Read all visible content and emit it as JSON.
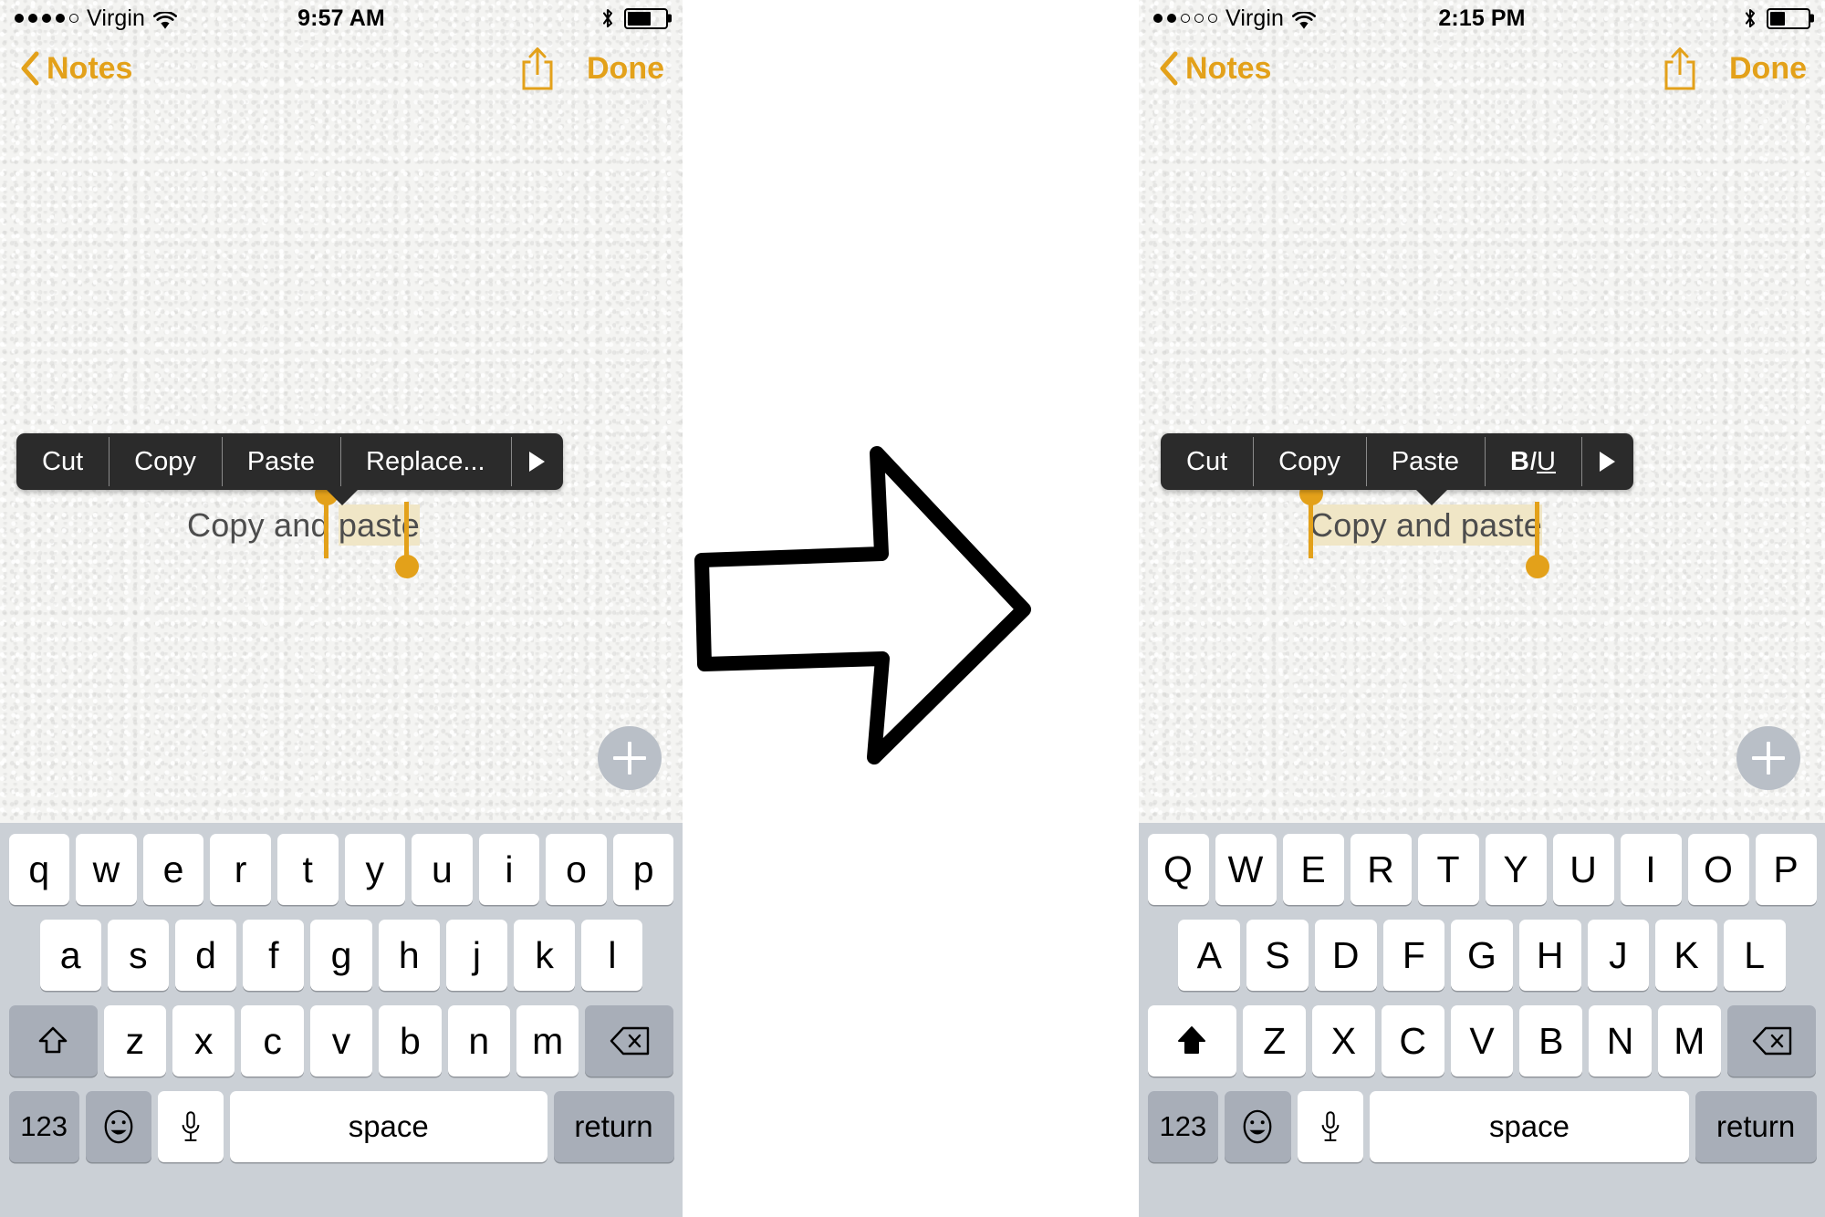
{
  "colors": {
    "accent_gold": "#e3a11a",
    "selection_highlight": "#f0e6c6",
    "callout_bg": "#2b2b2b",
    "keyboard_bg": "#cbd0d6",
    "key_bg": "#ffffff",
    "modifier_key_bg": "#a8aeb8",
    "note_paper": "#f4f4f2",
    "note_text": "#4d4d4d",
    "plus_button_bg": "#b9bfc7"
  },
  "panels": [
    {
      "id": "before",
      "status_bar": {
        "signal_dots_filled": 4,
        "signal_dots_total": 5,
        "carrier": "Virgin",
        "wifi_icon": "wifi-icon",
        "time": "9:57 AM",
        "bluetooth_icon": "bluetooth-icon",
        "battery_percent": 62
      },
      "nav_bar": {
        "back_icon": "chevron-left-icon",
        "back_label": "Notes",
        "share_icon": "share-icon",
        "done_label": "Done"
      },
      "callout_menu": {
        "items": [
          "Cut",
          "Copy",
          "Paste",
          "Replace...",
          "more-arrow-icon"
        ]
      },
      "note": {
        "text_before": "Copy and ",
        "text_selected": "paste",
        "text_after": "",
        "full_text": "Copy and paste"
      },
      "add_button_icon": "plus-icon",
      "keyboard": {
        "shift_icon": "shift-outline-icon",
        "shift_active": false,
        "delete_icon": "delete-backspace-icon",
        "row1": [
          "q",
          "w",
          "e",
          "r",
          "t",
          "y",
          "u",
          "i",
          "o",
          "p"
        ],
        "row2": [
          "a",
          "s",
          "d",
          "f",
          "g",
          "h",
          "j",
          "k",
          "l"
        ],
        "row3": [
          "z",
          "x",
          "c",
          "v",
          "b",
          "n",
          "m"
        ],
        "numeric_label": "123",
        "emoji_icon": "emoji-smiley-icon",
        "dictation_icon": "microphone-icon",
        "space_label": "space",
        "return_label": "return"
      }
    },
    {
      "id": "after",
      "status_bar": {
        "signal_dots_filled": 2,
        "signal_dots_total": 5,
        "carrier": "Virgin",
        "wifi_icon": "wifi-icon",
        "time": "2:15 PM",
        "bluetooth_icon": "bluetooth-icon",
        "battery_percent": 40
      },
      "nav_bar": {
        "back_icon": "chevron-left-icon",
        "back_label": "Notes",
        "share_icon": "share-icon",
        "done_label": "Done"
      },
      "callout_menu": {
        "items": [
          "Cut",
          "Copy",
          "Paste",
          "BIU",
          "more-arrow-icon"
        ],
        "format_b": "B",
        "format_i": "I",
        "format_u": "U"
      },
      "note": {
        "text_before": "",
        "text_selected": "Copy and paste",
        "text_after": "",
        "full_text": "Copy and paste"
      },
      "add_button_icon": "plus-icon",
      "keyboard": {
        "shift_icon": "shift-filled-icon",
        "shift_active": true,
        "delete_icon": "delete-backspace-icon",
        "row1": [
          "Q",
          "W",
          "E",
          "R",
          "T",
          "Y",
          "U",
          "I",
          "O",
          "P"
        ],
        "row2": [
          "A",
          "S",
          "D",
          "F",
          "G",
          "H",
          "J",
          "K",
          "L"
        ],
        "row3": [
          "Z",
          "X",
          "C",
          "V",
          "B",
          "N",
          "M"
        ],
        "numeric_label": "123",
        "emoji_icon": "emoji-smiley-icon",
        "dictation_icon": "microphone-icon",
        "space_label": "space",
        "return_label": "return"
      }
    }
  ],
  "transition_arrow_icon": "right-arrow-icon"
}
